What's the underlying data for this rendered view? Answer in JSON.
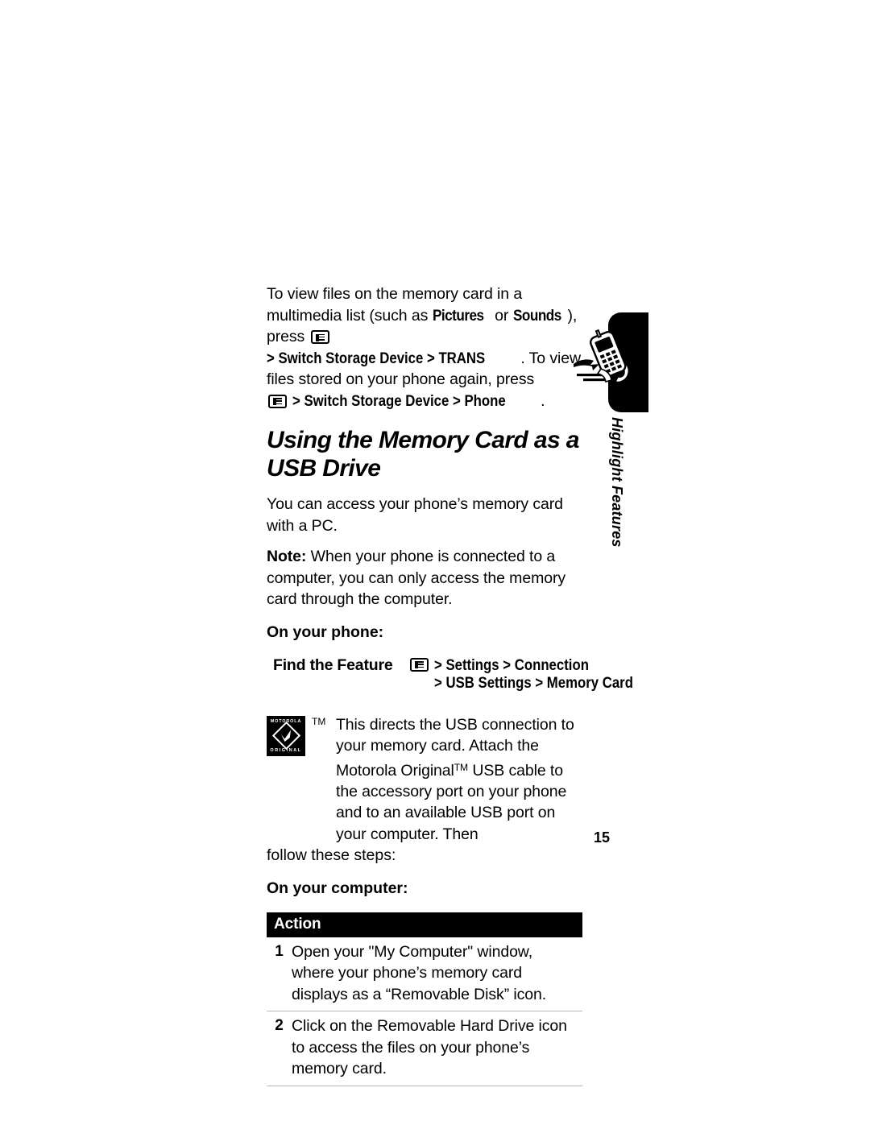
{
  "page": {
    "number": "15",
    "side_tab_label": "Highlight Features",
    "side_tab_icon": "running-phone-icon"
  },
  "intro": {
    "line1a": "To view files on the memory card in a multimedia list (such",
    "line2a": "as ",
    "bold_pictures": "Pictures",
    "line2b": " or ",
    "bold_sounds": "Sounds",
    "line2c": "), press ",
    "path1": "> Switch Storage Device > TRANS",
    "line2d": ".",
    "line3": "To view files stored on your phone again, press",
    "path2": "> Switch Storage Device > Phone",
    "line4_end": "."
  },
  "heading": "Using the Memory Card as a USB Drive",
  "body": {
    "p1": "You can access your phone’s memory card with a PC.",
    "note_label": "Note:",
    "note_text": " When your phone is connected to a computer, you can only access the memory card through the computer."
  },
  "on_phone": {
    "subhead": "On your phone:",
    "find_feature_label": "Find the Feature",
    "key_icon": "menu-key-icon",
    "path_line1": "> Settings > Connection",
    "path_line2": "> USB Settings > Memory Card"
  },
  "motorola": {
    "logo_top": "MOTOROLA",
    "logo_bottom": "ORIGINAL",
    "tm_mark": "TM",
    "text": "This directs the USB connection to your memory card. Attach the Motorola Original",
    "text_tm": "TM",
    "text_after": " USB cable to the accessory port on your phone and to an available USB port on your computer. Then",
    "follow": "follow these steps:"
  },
  "on_computer": {
    "subhead": "On your computer:"
  },
  "action_table": {
    "header": "Action",
    "rows": [
      {
        "num": "1",
        "text": "Open your \"My Computer\" window, where your phone’s memory card displays as a “Removable Disk” icon."
      },
      {
        "num": "2",
        "text": "Click on the Removable Hard Drive icon to access the files on your phone’s memory card."
      }
    ]
  },
  "colors": {
    "ink": "#000000",
    "paper": "#ffffff",
    "rule": "#b7b7b7"
  }
}
